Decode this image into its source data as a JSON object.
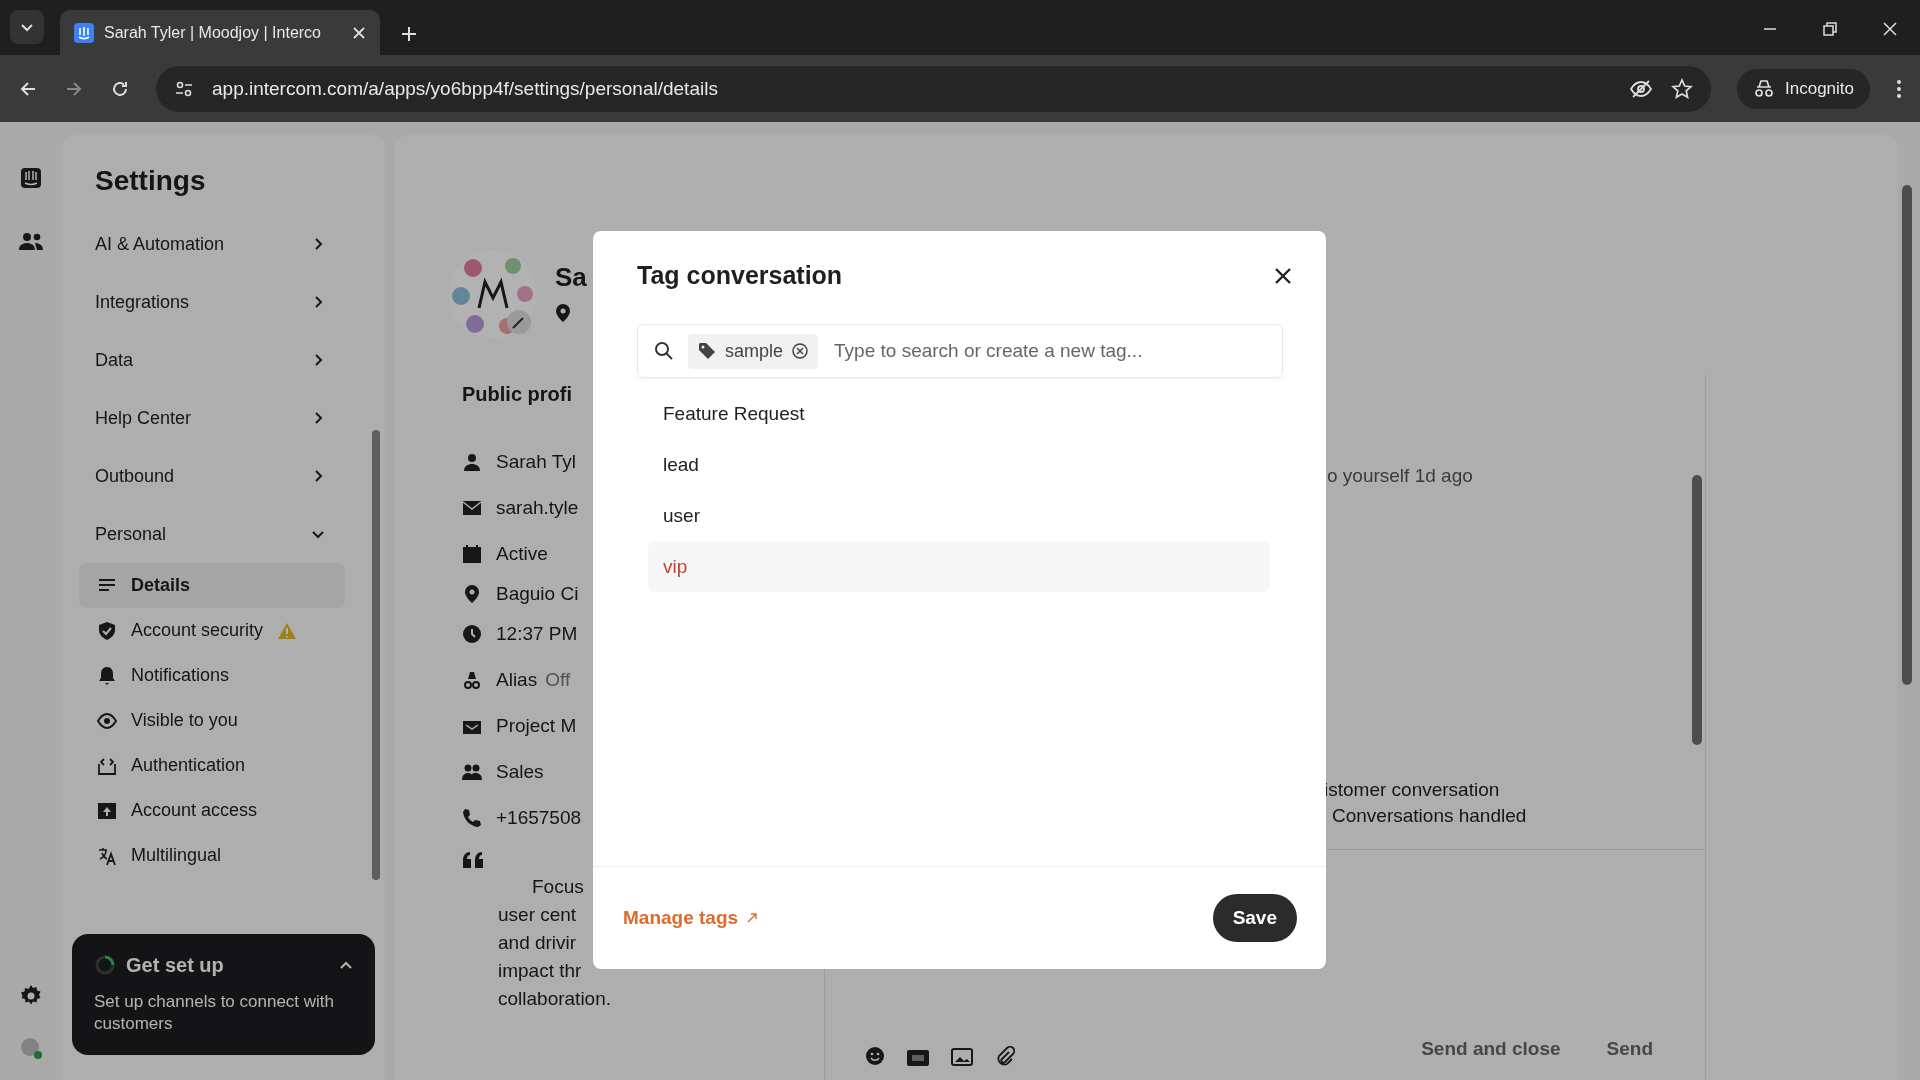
{
  "browser": {
    "tab_title": "Sarah Tyler | Moodjoy | Interco",
    "url": "app.intercom.com/a/apps/yo6bpp4f/settings/personal/details",
    "profile_label": "Incognito"
  },
  "settings": {
    "title": "Settings",
    "sections": [
      {
        "label": "AI & Automation",
        "expanded": false
      },
      {
        "label": "Integrations",
        "expanded": false
      },
      {
        "label": "Data",
        "expanded": false
      },
      {
        "label": "Help Center",
        "expanded": false
      },
      {
        "label": "Outbound",
        "expanded": false
      },
      {
        "label": "Personal",
        "expanded": true,
        "items": [
          {
            "label": "Details",
            "selected": true,
            "warning": false
          },
          {
            "label": "Account security",
            "selected": false,
            "warning": true
          },
          {
            "label": "Notifications",
            "selected": false,
            "warning": false
          },
          {
            "label": "Visible to you",
            "selected": false,
            "warning": false
          },
          {
            "label": "Authentication",
            "selected": false,
            "warning": false
          },
          {
            "label": "Account access",
            "selected": false,
            "warning": false
          },
          {
            "label": "Multilingual",
            "selected": false,
            "warning": false
          }
        ]
      }
    ]
  },
  "setup_card": {
    "title": "Get set up",
    "text": "Set up channels to connect with customers"
  },
  "profile": {
    "name": "Sa",
    "section_heading": "Public profi",
    "fields": [
      {
        "kind": "text",
        "text": "Sarah Tyl"
      },
      {
        "kind": "text",
        "text": "sarah.tyle"
      },
      {
        "kind": "text",
        "text": "Active"
      },
      {
        "kind": "text",
        "text": "Baguio Ci"
      },
      {
        "kind": "text",
        "text": "12:37 PM"
      },
      {
        "kind": "toggle",
        "label": "Alias",
        "value": "Off"
      },
      {
        "kind": "text",
        "text": "Project M"
      },
      {
        "kind": "text",
        "text": "Sales"
      },
      {
        "kind": "text",
        "text": "+1657508"
      }
    ],
    "bio_lines": [
      "Focus",
      "user cent",
      "and drivir",
      "impact thr",
      "collaboration."
    ]
  },
  "conversation": {
    "activity": "o yourself 1d ago",
    "note_lines": [
      "istomer conversation",
      "Conversations handled"
    ],
    "actions": [
      "Send and close",
      "Send"
    ]
  },
  "modal": {
    "title": "Tag conversation",
    "chip": "sample",
    "placeholder": "Type to search or create a new tag...",
    "tags": [
      {
        "label": "Feature Request",
        "selected": false
      },
      {
        "label": "lead",
        "selected": false
      },
      {
        "label": "user",
        "selected": false
      },
      {
        "label": "vip",
        "selected": true
      }
    ],
    "link": "Manage tags",
    "save": "Save"
  }
}
